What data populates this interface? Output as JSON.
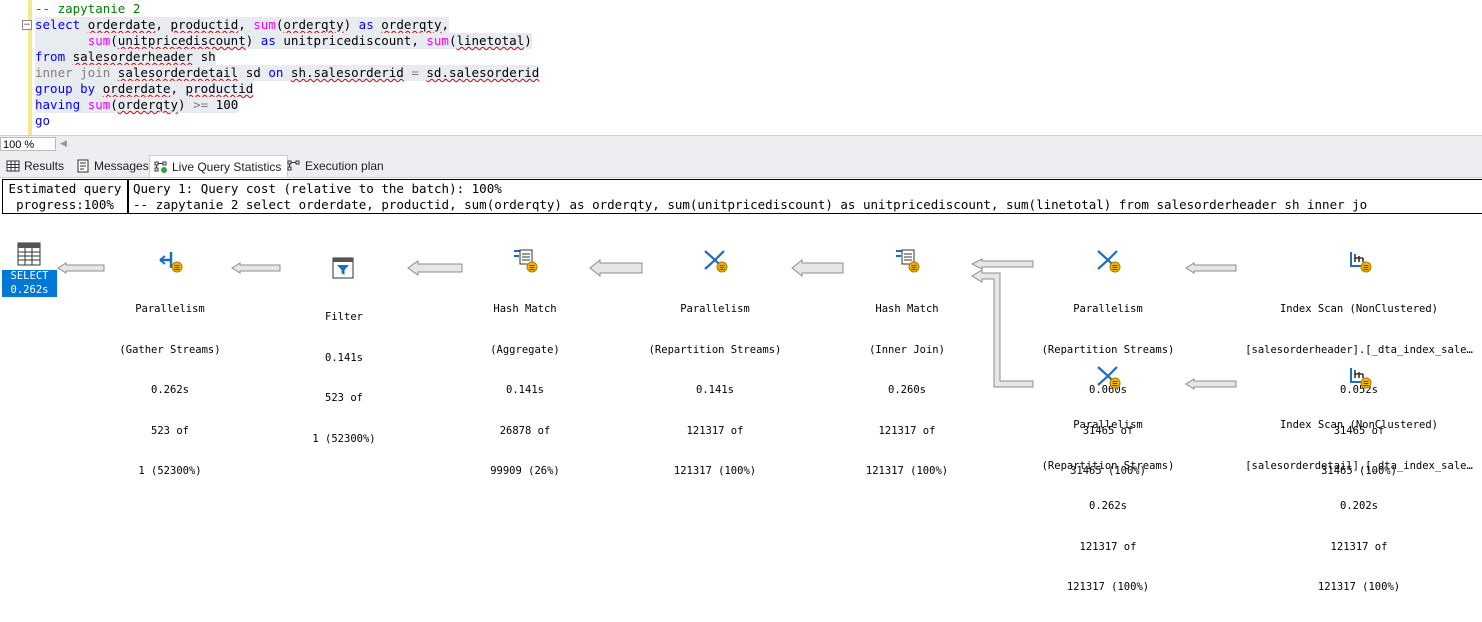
{
  "editor": {
    "lines": [
      "-- zapytanie 2",
      "select orderdate, productid, sum(orderqty) as orderqty,",
      "       sum(unitpricediscount) as unitpricediscount, sum(linetotal)",
      "from salesorderheader sh",
      "inner join salesorderdetail sd on sh.salesorderid = sd.salesorderid",
      "group by orderdate, productid",
      "having sum(orderqty) >= 100",
      "go"
    ]
  },
  "status": {
    "zoom": "100 %"
  },
  "tabs": [
    {
      "label": "Results",
      "icon": "grid-icon"
    },
    {
      "label": "Messages",
      "icon": "messages-icon"
    },
    {
      "label": "Live Query Statistics",
      "icon": "live-stats-icon"
    },
    {
      "label": "Execution plan",
      "icon": "plan-icon"
    }
  ],
  "query_info": {
    "progress_line1": "Estimated query",
    "progress_line2": "progress:100%",
    "cost_line": "Query 1: Query cost (relative to the batch): 100%",
    "sql_line": "-- zapytanie 2 select orderdate, productid, sum(orderqty) as orderqty, sum(unitpricediscount) as unitpricediscount, sum(linetotal) from salesorderheader sh inner jo"
  },
  "plan": {
    "select": {
      "label": "SELECT",
      "time": "0.262s"
    },
    "nodes": [
      {
        "id": "gather",
        "name": "Parallelism",
        "sub": "(Gather Streams)",
        "time": "0.262s",
        "rows": "523 of",
        "est": "1 (52300%)"
      },
      {
        "id": "filter",
        "name": "Filter",
        "sub": "",
        "time": "0.141s",
        "rows": "523 of",
        "est": "1 (52300%)"
      },
      {
        "id": "hashagg",
        "name": "Hash Match",
        "sub": "(Aggregate)",
        "time": "0.141s",
        "rows": "26878 of",
        "est": "99909 (26%)"
      },
      {
        "id": "repart1",
        "name": "Parallelism",
        "sub": "(Repartition Streams)",
        "time": "0.141s",
        "rows": "121317 of",
        "est": "121317 (100%)"
      },
      {
        "id": "hashjoin",
        "name": "Hash Match",
        "sub": "(Inner Join)",
        "time": "0.260s",
        "rows": "121317 of",
        "est": "121317 (100%)"
      },
      {
        "id": "repart2",
        "name": "Parallelism",
        "sub": "(Repartition Streams)",
        "time": "0.060s",
        "rows": "31465 of",
        "est": "31465 (100%)"
      },
      {
        "id": "scan1",
        "name": "Index Scan (NonClustered)",
        "sub": "[salesorderheader].[_dta_index_sale…",
        "time": "0.052s",
        "rows": "31465 of",
        "est": "31465 (100%)"
      },
      {
        "id": "repart3",
        "name": "Parallelism",
        "sub": "(Repartition Streams)",
        "time": "0.262s",
        "rows": "121317 of",
        "est": "121317 (100%)"
      },
      {
        "id": "scan2",
        "name": "Index Scan (NonClustered)",
        "sub": "[salesorderdetail].[_dta_index_sale…",
        "time": "0.202s",
        "rows": "121317 of",
        "est": "121317 (100%)"
      }
    ]
  },
  "colors": {
    "keyword": "#0000ff",
    "function": "#ff00ff",
    "comment": "#008000",
    "accent": "#0078d7"
  }
}
